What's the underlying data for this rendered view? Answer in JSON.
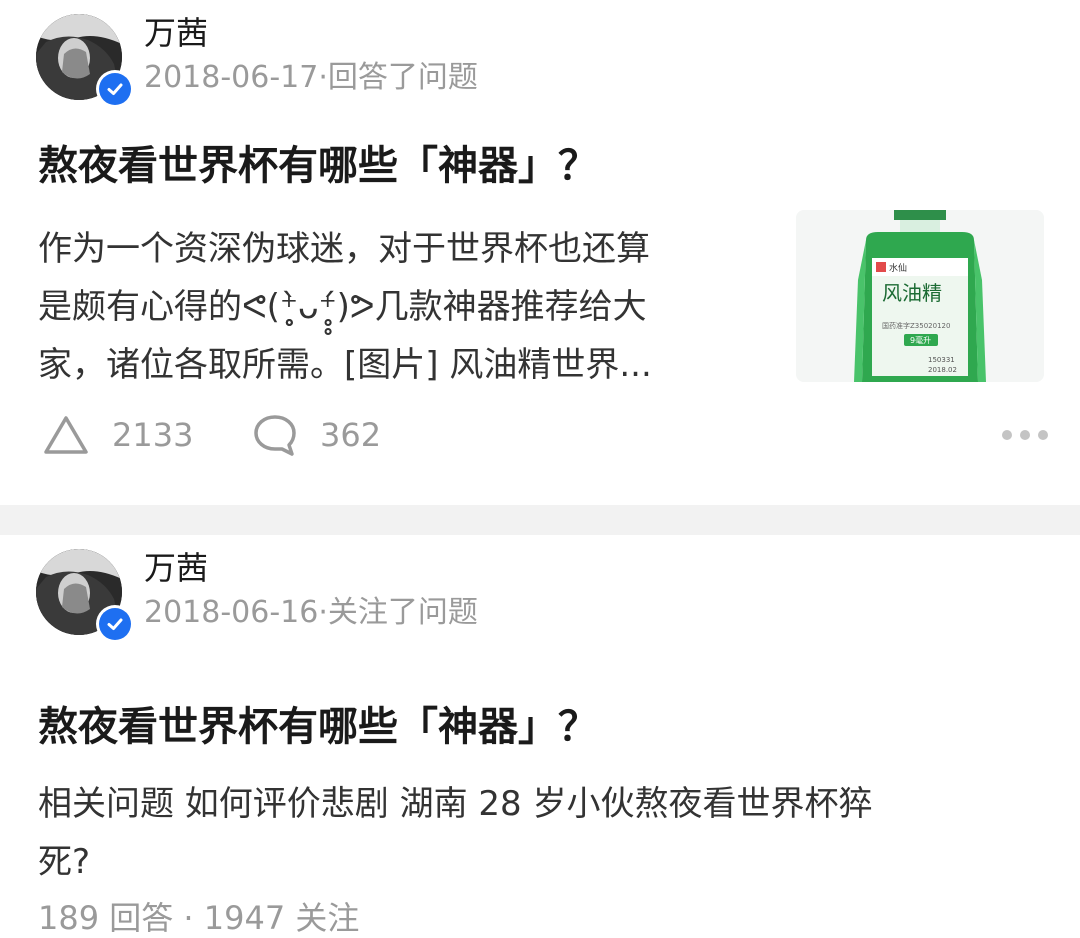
{
  "feed": [
    {
      "author": "万茜",
      "meta": "2018-06-17·回答了问题",
      "title": "熬夜看世界杯有哪些「神器」？",
      "excerpt_lines": [
        "作为一个资深伪球迷，对于世界杯也还算",
        "是颇有心得的ᕙ(⁺̥̥̀ᴗ⁺̥̥́)ᕗ几款神器推荐给大",
        "家，诸位各取所需。[图片] 风油精世界..."
      ],
      "thumbnail": {
        "label_brand": "水仙",
        "label_name": "风油精",
        "label_volume": "9毫升",
        "label_approval": "国药准字Z35020120",
        "label_batch": "150331",
        "label_expiry": "2018.02"
      },
      "upvotes": "2133",
      "comments": "362",
      "icons": {
        "upvote": "triangle-upvote-icon",
        "comment": "comment-bubble-icon",
        "more": "more-dots-icon"
      }
    },
    {
      "author": "万茜",
      "meta": "2018-06-16·关注了问题",
      "title": "熬夜看世界杯有哪些「神器」？",
      "related_lines": [
        "相关问题 如何评价悲剧 湖南 28 岁小伙熬夜看世界杯猝",
        "死?"
      ],
      "stats": "189 回答 · 1947 关注"
    }
  ],
  "colors": {
    "verified_badge": "#1e6ff1",
    "muted_text": "#9a9a9a",
    "separator": "#f2f2f2",
    "bottle_green": "#2fa84f"
  }
}
